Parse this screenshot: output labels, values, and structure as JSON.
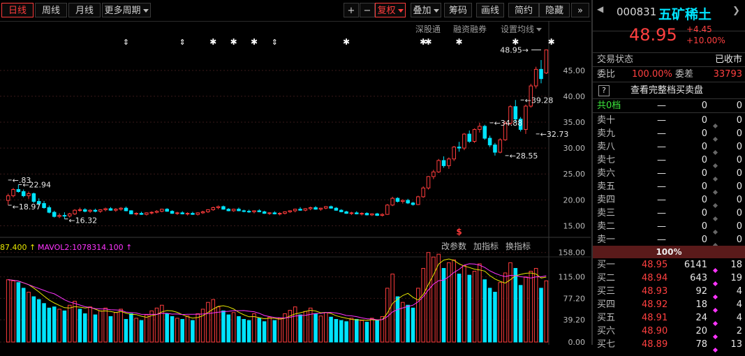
{
  "toolbar": {
    "tabs": [
      "日线",
      "周线",
      "月线"
    ],
    "more_periods": "更多周期",
    "plus": "+",
    "minus": "−",
    "fuquan": "复权",
    "overlay": "叠加",
    "chips": "筹码",
    "draw": "画线",
    "simple": "简约",
    "hide": "隐藏",
    "expand": "»"
  },
  "subbar": {
    "shenzhen_connect": "深股通",
    "margin": "融资融券",
    "ma_settings": "设置均线"
  },
  "colors": {
    "up": "#ff3c3c",
    "down": "#00e4ff",
    "ma_yellow": "#e6e600",
    "ma_magenta": "#ff34ff",
    "grid": "#3a1a1a"
  },
  "chart_data": {
    "type": "candlestick",
    "price_axis_ticks": [
      "45.00",
      "40.00",
      "35.00",
      "30.00",
      "25.00",
      "20.00",
      "15.00"
    ],
    "price_range": [
      12.5,
      50.5
    ],
    "annotations": [
      {
        "label": "48.95",
        "price": 48.95,
        "bar": 104
      },
      {
        "label": "39.28",
        "price": 39.28,
        "bar": 100
      },
      {
        "label": "34.88",
        "price": 34.88,
        "bar": 94
      },
      {
        "label": "32.73",
        "price": 32.73,
        "bar": 103
      },
      {
        "label": "28.55",
        "price": 28.55,
        "bar": 97
      },
      {
        "label": "22.94",
        "price": 22.94,
        "bar": 2
      },
      {
        "label": "18.97",
        "price": 18.97,
        "bar": 0
      },
      {
        "label": "16.32",
        "price": 16.32,
        "bar": 11
      },
      {
        "label": ".83",
        "price": 23.83,
        "bar": 0
      }
    ],
    "event_marks": {
      "star_bars": [
        40,
        44,
        48,
        66,
        81,
        82,
        88,
        99,
        106
      ],
      "arrow_bars": [
        23,
        34,
        52
      ],
      "dollar_bar": 88
    },
    "candles": [
      [
        19.9,
        21.2,
        19.0,
        20.8
      ],
      [
        20.8,
        22.3,
        20.5,
        22.0
      ],
      [
        22.0,
        22.94,
        21.4,
        21.6
      ],
      [
        21.6,
        22.0,
        20.5,
        20.8
      ],
      [
        20.8,
        21.6,
        20.2,
        21.2
      ],
      [
        21.2,
        21.4,
        19.4,
        19.7
      ],
      [
        19.7,
        20.3,
        19.0,
        19.3
      ],
      [
        19.3,
        19.8,
        18.3,
        18.5
      ],
      [
        18.5,
        18.9,
        17.4,
        17.6
      ],
      [
        17.6,
        17.9,
        16.6,
        16.8
      ],
      [
        16.8,
        17.4,
        16.5,
        17.0
      ],
      [
        17.0,
        17.6,
        16.32,
        16.9
      ],
      [
        16.9,
        17.5,
        16.6,
        17.3
      ],
      [
        17.3,
        18.2,
        17.1,
        18.0
      ],
      [
        18.0,
        18.5,
        17.7,
        18.1
      ],
      [
        18.1,
        18.4,
        17.6,
        17.8
      ],
      [
        17.8,
        18.2,
        17.5,
        18.0
      ],
      [
        18.0,
        18.3,
        17.6,
        17.8
      ],
      [
        17.8,
        18.2,
        17.5,
        18.1
      ],
      [
        18.1,
        18.5,
        17.8,
        18.3
      ],
      [
        18.3,
        18.6,
        17.9,
        18.0
      ],
      [
        18.0,
        18.4,
        17.7,
        18.2
      ],
      [
        18.2,
        18.6,
        17.9,
        18.4
      ],
      [
        18.4,
        18.7,
        17.8,
        17.9
      ],
      [
        17.9,
        18.0,
        17.2,
        17.3
      ],
      [
        17.3,
        17.6,
        17.0,
        17.4
      ],
      [
        17.4,
        17.7,
        17.1,
        17.2
      ],
      [
        17.2,
        17.6,
        17.0,
        17.5
      ],
      [
        17.5,
        17.8,
        17.2,
        17.6
      ],
      [
        17.6,
        18.0,
        17.4,
        17.8
      ],
      [
        17.8,
        18.3,
        17.6,
        18.2
      ],
      [
        18.2,
        18.4,
        17.7,
        17.8
      ],
      [
        17.8,
        18.0,
        17.3,
        17.4
      ],
      [
        17.4,
        17.7,
        17.1,
        17.5
      ],
      [
        17.5,
        17.8,
        17.2,
        17.3
      ],
      [
        17.3,
        17.6,
        17.0,
        17.4
      ],
      [
        17.4,
        17.7,
        17.1,
        17.2
      ],
      [
        17.2,
        17.6,
        17.0,
        17.5
      ],
      [
        17.5,
        17.9,
        17.3,
        17.7
      ],
      [
        17.7,
        18.2,
        17.5,
        18.1
      ],
      [
        18.1,
        18.7,
        17.9,
        18.5
      ],
      [
        18.5,
        18.9,
        18.2,
        18.7
      ],
      [
        18.7,
        18.9,
        18.1,
        18.2
      ],
      [
        18.2,
        18.4,
        17.8,
        17.9
      ],
      [
        17.9,
        18.3,
        17.7,
        18.2
      ],
      [
        18.2,
        18.5,
        17.8,
        17.9
      ],
      [
        17.9,
        18.1,
        17.6,
        17.8
      ],
      [
        17.8,
        18.1,
        17.5,
        17.7
      ],
      [
        17.7,
        18.0,
        17.4,
        17.9
      ],
      [
        17.9,
        18.2,
        17.6,
        17.7
      ],
      [
        17.7,
        17.9,
        17.3,
        17.4
      ],
      [
        17.4,
        17.6,
        17.1,
        17.5
      ],
      [
        17.5,
        17.8,
        17.2,
        17.3
      ],
      [
        17.3,
        17.6,
        17.0,
        17.4
      ],
      [
        17.4,
        17.8,
        17.2,
        17.7
      ],
      [
        17.7,
        18.0,
        17.5,
        17.9
      ],
      [
        17.9,
        18.3,
        17.6,
        18.2
      ],
      [
        18.2,
        18.6,
        17.9,
        18.0
      ],
      [
        18.0,
        18.4,
        17.8,
        18.3
      ],
      [
        18.3,
        18.7,
        18.0,
        18.5
      ],
      [
        18.5,
        18.8,
        18.1,
        18.2
      ],
      [
        18.2,
        18.5,
        17.9,
        18.4
      ],
      [
        18.4,
        18.8,
        18.2,
        18.7
      ],
      [
        18.7,
        18.9,
        18.3,
        18.4
      ],
      [
        18.4,
        18.6,
        17.9,
        18.0
      ],
      [
        18.0,
        18.2,
        17.6,
        17.7
      ],
      [
        17.7,
        17.9,
        17.3,
        17.4
      ],
      [
        17.4,
        17.7,
        17.1,
        17.5
      ],
      [
        17.5,
        17.8,
        17.2,
        17.3
      ],
      [
        17.3,
        17.6,
        17.0,
        17.4
      ],
      [
        17.4,
        17.6,
        17.0,
        17.1
      ],
      [
        17.1,
        17.4,
        16.9,
        17.3
      ],
      [
        17.3,
        17.5,
        16.9,
        17.0
      ],
      [
        17.0,
        17.4,
        16.8,
        17.2
      ],
      [
        17.2,
        19.2,
        17.1,
        19.0
      ],
      [
        19.0,
        20.6,
        18.8,
        20.3
      ],
      [
        20.3,
        20.5,
        19.5,
        19.7
      ],
      [
        19.7,
        20.1,
        19.3,
        19.9
      ],
      [
        19.9,
        20.2,
        19.2,
        19.4
      ],
      [
        19.4,
        19.6,
        18.9,
        19.1
      ],
      [
        19.1,
        20.8,
        19.0,
        20.6
      ],
      [
        20.6,
        22.6,
        20.4,
        22.3
      ],
      [
        22.3,
        24.6,
        22.0,
        24.5
      ],
      [
        24.5,
        25.8,
        24.0,
        25.4
      ],
      [
        25.4,
        27.9,
        25.2,
        27.6
      ],
      [
        27.6,
        28.4,
        26.2,
        26.6
      ],
      [
        26.6,
        28.2,
        26.0,
        27.9
      ],
      [
        27.9,
        30.4,
        27.5,
        30.2
      ],
      [
        30.2,
        31.2,
        29.3,
        30.0
      ],
      [
        30.0,
        32.9,
        29.6,
        32.7
      ],
      [
        32.7,
        33.4,
        31.0,
        31.3
      ],
      [
        31.3,
        33.8,
        31.0,
        33.6
      ],
      [
        33.6,
        34.88,
        33.0,
        34.2
      ],
      [
        34.2,
        34.5,
        31.6,
        31.9
      ],
      [
        31.9,
        32.4,
        30.2,
        30.6
      ],
      [
        30.6,
        31.0,
        28.55,
        29.2
      ],
      [
        29.2,
        31.9,
        29.0,
        31.6
      ],
      [
        31.6,
        35.2,
        31.4,
        34.8
      ],
      [
        34.8,
        38.3,
        34.5,
        38.0
      ],
      [
        38.0,
        39.28,
        35.0,
        35.6
      ],
      [
        35.6,
        36.0,
        33.2,
        33.6
      ],
      [
        33.6,
        38.4,
        32.73,
        38.1
      ],
      [
        38.1,
        42.4,
        37.8,
        42.0
      ],
      [
        42.0,
        45.7,
        41.5,
        45.2
      ],
      [
        45.2,
        47.0,
        42.5,
        43.4
      ],
      [
        44.5,
        48.95,
        44.3,
        48.95
      ]
    ],
    "volume_axis_ticks": [
      "158.00",
      "115.00",
      "77.20",
      "39.20",
      "0.00"
    ],
    "volume_range": [
      0,
      170
    ],
    "volume_legend": {
      "mavol1_label": "87.400",
      "mavol2_label": "MAVOL2:1078314.100"
    },
    "volume_tools": [
      "改参数",
      "加指标",
      "换指标"
    ],
    "volume": [
      [
        110,
        0
      ],
      [
        108,
        0
      ],
      [
        105,
        1
      ],
      [
        95,
        1
      ],
      [
        88,
        0
      ],
      [
        80,
        1
      ],
      [
        75,
        1
      ],
      [
        68,
        1
      ],
      [
        60,
        1
      ],
      [
        62,
        1
      ],
      [
        58,
        0
      ],
      [
        55,
        1
      ],
      [
        65,
        0
      ],
      [
        72,
        0
      ],
      [
        58,
        1
      ],
      [
        50,
        1
      ],
      [
        62,
        0
      ],
      [
        48,
        1
      ],
      [
        55,
        0
      ],
      [
        60,
        0
      ],
      [
        45,
        1
      ],
      [
        52,
        0
      ],
      [
        58,
        0
      ],
      [
        40,
        1
      ],
      [
        50,
        1
      ],
      [
        42,
        0
      ],
      [
        38,
        1
      ],
      [
        48,
        0
      ],
      [
        55,
        0
      ],
      [
        60,
        0
      ],
      [
        65,
        0
      ],
      [
        50,
        1
      ],
      [
        45,
        1
      ],
      [
        42,
        0
      ],
      [
        40,
        1
      ],
      [
        46,
        0
      ],
      [
        38,
        1
      ],
      [
        50,
        0
      ],
      [
        58,
        0
      ],
      [
        70,
        0
      ],
      [
        75,
        0
      ],
      [
        62,
        0
      ],
      [
        55,
        1
      ],
      [
        48,
        1
      ],
      [
        52,
        0
      ],
      [
        45,
        1
      ],
      [
        40,
        1
      ],
      [
        38,
        1
      ],
      [
        50,
        0
      ],
      [
        42,
        1
      ],
      [
        36,
        1
      ],
      [
        44,
        0
      ],
      [
        38,
        1
      ],
      [
        42,
        0
      ],
      [
        50,
        0
      ],
      [
        56,
        0
      ],
      [
        62,
        0
      ],
      [
        48,
        1
      ],
      [
        54,
        0
      ],
      [
        60,
        0
      ],
      [
        50,
        1
      ],
      [
        46,
        0
      ],
      [
        52,
        0
      ],
      [
        44,
        1
      ],
      [
        40,
        1
      ],
      [
        38,
        1
      ],
      [
        36,
        1
      ],
      [
        42,
        0
      ],
      [
        40,
        1
      ],
      [
        38,
        0
      ],
      [
        35,
        1
      ],
      [
        42,
        0
      ],
      [
        38,
        1
      ],
      [
        45,
        0
      ],
      [
        95,
        0
      ],
      [
        120,
        0
      ],
      [
        80,
        1
      ],
      [
        70,
        0
      ],
      [
        65,
        1
      ],
      [
        60,
        1
      ],
      [
        95,
        0
      ],
      [
        130,
        0
      ],
      [
        158,
        0
      ],
      [
        150,
        0
      ],
      [
        155,
        0
      ],
      [
        130,
        1
      ],
      [
        140,
        0
      ],
      [
        145,
        0
      ],
      [
        120,
        1
      ],
      [
        135,
        0
      ],
      [
        118,
        1
      ],
      [
        125,
        0
      ],
      [
        138,
        0
      ],
      [
        110,
        1
      ],
      [
        95,
        1
      ],
      [
        88,
        1
      ],
      [
        105,
        0
      ],
      [
        122,
        0
      ],
      [
        140,
        0
      ],
      [
        130,
        1
      ],
      [
        100,
        1
      ],
      [
        115,
        0
      ],
      [
        125,
        0
      ],
      [
        130,
        0
      ],
      [
        95,
        1
      ],
      [
        108,
        0
      ]
    ],
    "ma_vol_yellow": [],
    "ma_vol_magenta": []
  },
  "stock": {
    "code": "000831",
    "name": "五矿稀土",
    "price": "48.95",
    "change": "+4.45",
    "change_pct": "+10.00%",
    "status_label": "交易状态",
    "status_value": "已收市",
    "weibi_label": "委比",
    "weibi_value": "100.00%",
    "weicha_label": "委差",
    "weicha_value": "33793",
    "help_icon": "?",
    "full_book_label": "查看完整档买卖盘",
    "total_label": "共0档",
    "total_price": "—",
    "total_vol": "0",
    "total_cnt": "0",
    "asks": [
      {
        "label": "卖十",
        "price": "—",
        "vol": "0",
        "cnt": "0"
      },
      {
        "label": "卖九",
        "price": "—",
        "vol": "0",
        "cnt": "0"
      },
      {
        "label": "卖八",
        "price": "—",
        "vol": "0",
        "cnt": "0"
      },
      {
        "label": "卖七",
        "price": "—",
        "vol": "0",
        "cnt": "0"
      },
      {
        "label": "卖六",
        "price": "—",
        "vol": "0",
        "cnt": "0"
      },
      {
        "label": "卖五",
        "price": "—",
        "vol": "0",
        "cnt": "0"
      },
      {
        "label": "卖四",
        "price": "—",
        "vol": "0",
        "cnt": "0"
      },
      {
        "label": "卖三",
        "price": "—",
        "vol": "0",
        "cnt": "0"
      },
      {
        "label": "卖二",
        "price": "—",
        "vol": "0",
        "cnt": "0"
      },
      {
        "label": "卖一",
        "price": "—",
        "vol": "0",
        "cnt": "0"
      }
    ],
    "ratio_bar": "100%",
    "bids": [
      {
        "label": "买一",
        "price": "48.95",
        "vol": "6141",
        "cnt": "18"
      },
      {
        "label": "买二",
        "price": "48.94",
        "vol": "643",
        "cnt": "19"
      },
      {
        "label": "买三",
        "price": "48.93",
        "vol": "92",
        "cnt": "4"
      },
      {
        "label": "买四",
        "price": "48.92",
        "vol": "18",
        "cnt": "4"
      },
      {
        "label": "买五",
        "price": "48.91",
        "vol": "24",
        "cnt": "4"
      },
      {
        "label": "买六",
        "price": "48.90",
        "vol": "20",
        "cnt": "2"
      },
      {
        "label": "买七",
        "price": "48.89",
        "vol": "78",
        "cnt": "13"
      }
    ]
  }
}
